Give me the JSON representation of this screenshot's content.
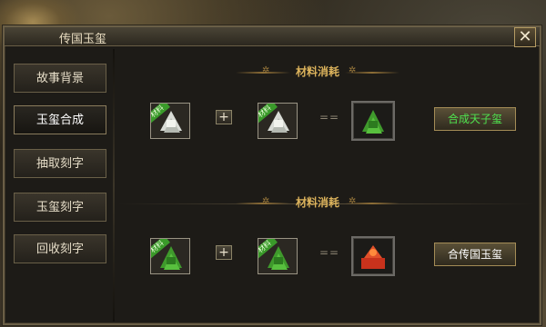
{
  "window": {
    "title": "传国玉玺",
    "close_label": "✕"
  },
  "sidebar": {
    "items": [
      {
        "label": "故事背景",
        "active": false
      },
      {
        "label": "玉玺合成",
        "active": true
      },
      {
        "label": "抽取刻字",
        "active": false
      },
      {
        "label": "玉玺刻字",
        "active": false
      },
      {
        "label": "回收刻字",
        "active": false
      }
    ]
  },
  "recipes": [
    {
      "heading": "材料消耗",
      "material_tag": "材料",
      "operator": "+",
      "equals": "==",
      "material_color": "white",
      "result": "green-jade-seal",
      "action_label": "合成天子玺",
      "action_color": "green"
    },
    {
      "heading": "材料消耗",
      "material_tag": "材料",
      "operator": "+",
      "equals": "==",
      "material_color": "green",
      "result": "red-jade-seal",
      "action_label": "合传国玉玺",
      "action_color": "white"
    }
  ]
}
